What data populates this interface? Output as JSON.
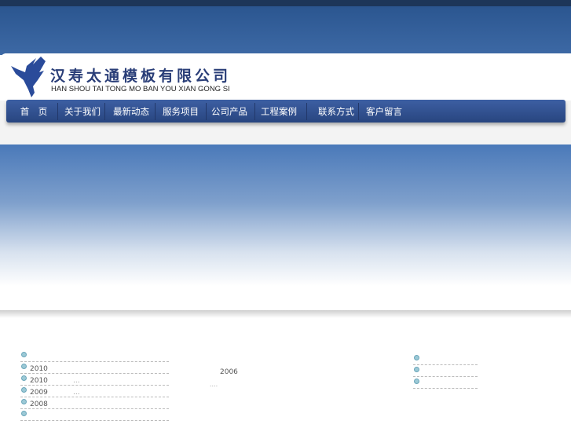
{
  "header": {
    "company_cn": "汉寿太通模板有限公司",
    "company_en": "HAN SHOU TAI TONG MO BAN YOU XIAN GONG SI"
  },
  "nav": [
    "首　页",
    "关于我们",
    "最新动态",
    "服务项目",
    "公司产品",
    "工程案例",
    "联系方式",
    "客户留言"
  ],
  "news_list": [
    {
      "text": ""
    },
    {
      "text": "2010"
    },
    {
      "text": "2010",
      "extra": "..."
    },
    {
      "text": "2009",
      "extra": "..."
    },
    {
      "text": "2008"
    },
    {
      "text": ""
    }
  ],
  "intro": {
    "year": "2006",
    "more": "...."
  },
  "right_list": [
    {
      "text": ""
    },
    {
      "text": ""
    },
    {
      "text": ""
    }
  ]
}
